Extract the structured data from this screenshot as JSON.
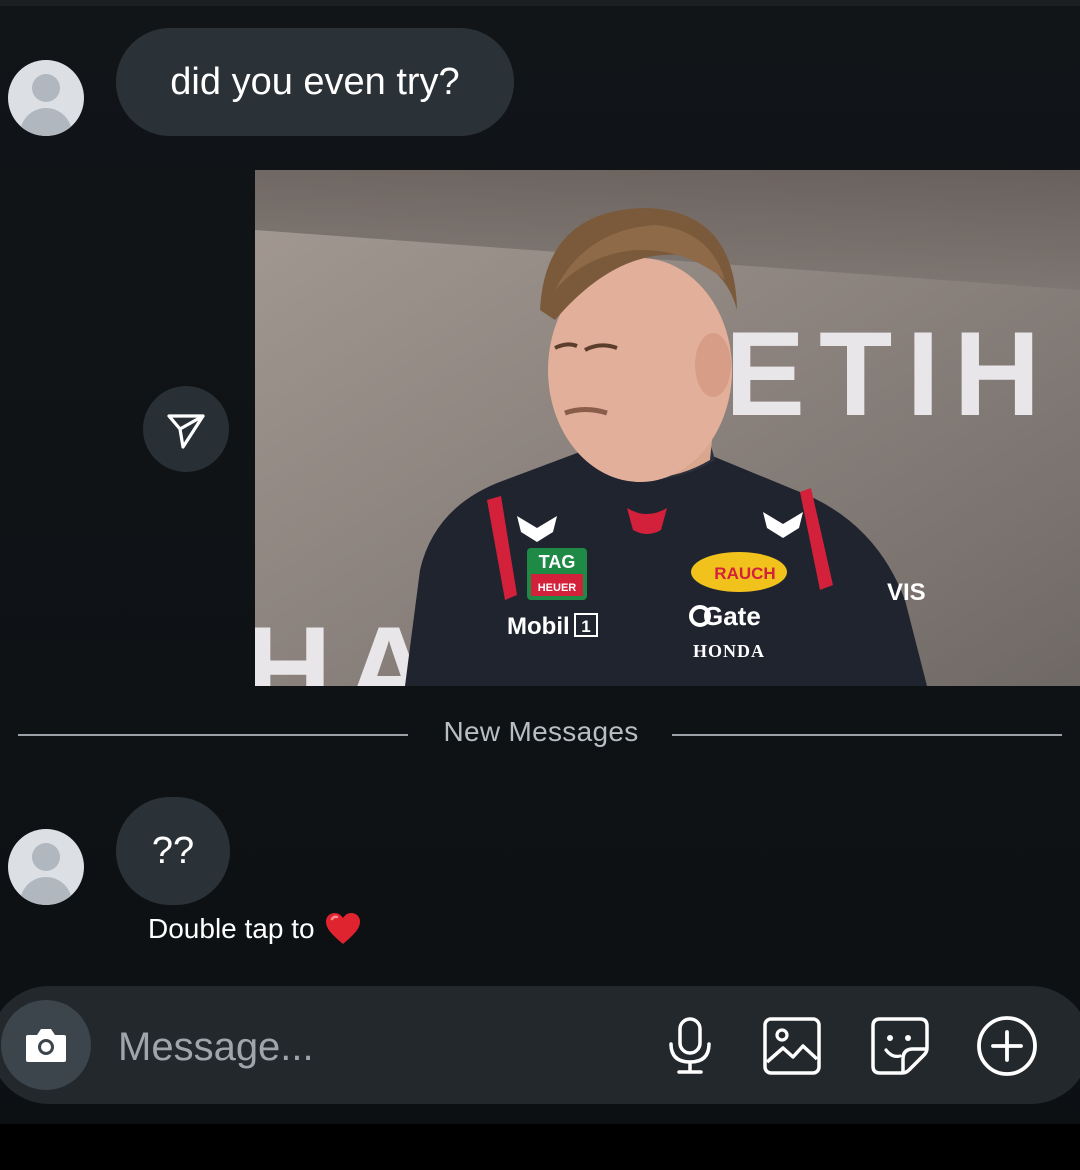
{
  "messages": {
    "first": {
      "text": "did you even try?"
    },
    "second": {
      "text": "??"
    },
    "reaction_hint": "Double tap to",
    "reaction_emoji": "❤️"
  },
  "video": {
    "banner_text_right": "ETIH",
    "banner_text_left": "HA",
    "suit": {
      "sponsor_tag": "TAG",
      "sponsor_tag_sub": "HEUER",
      "sponsor_rauch": "RAUCH",
      "sponsor_gate": "Gate",
      "sponsor_honda": "HONDA",
      "sponsor_mobil": "Mobil",
      "sponsor_mobil_num": "1",
      "sponsor_vis": "VIS"
    }
  },
  "divider": {
    "label": "New Messages"
  },
  "composer": {
    "placeholder": "Message..."
  },
  "icons": {
    "avatar": "default-avatar-icon",
    "share": "paper-plane-icon",
    "camera": "camera-icon",
    "mic": "microphone-icon",
    "gallery": "image-icon",
    "sticker": "sticker-icon",
    "add": "plus-circle-icon"
  },
  "colors": {
    "background": "#0f1316",
    "bubble": "#2b3237",
    "composer": "#23282c",
    "heart": "#e0242f"
  }
}
